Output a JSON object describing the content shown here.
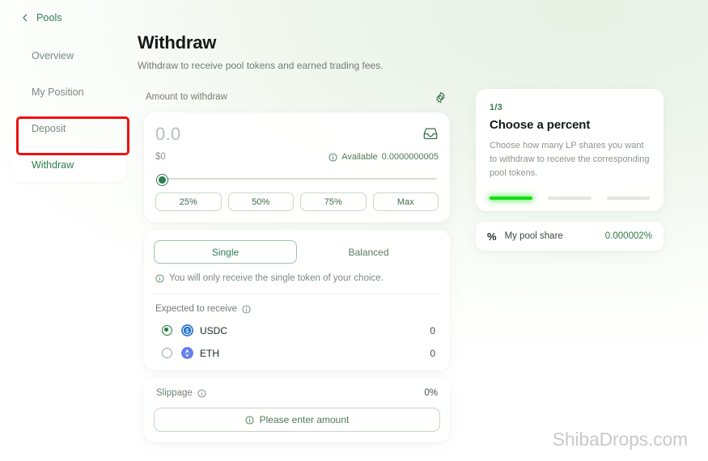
{
  "sidebar": {
    "back_label": "Pools",
    "back_icon": "chevron-left-icon",
    "items": [
      {
        "label": "Overview",
        "active": false
      },
      {
        "label": "My Position",
        "active": false
      },
      {
        "label": "Deposit",
        "active": false
      },
      {
        "label": "Withdraw",
        "active": true
      }
    ]
  },
  "header": {
    "title": "Withdraw",
    "subtitle": "Withdraw to receive pool tokens and earned trading fees."
  },
  "amount": {
    "section_label": "Amount to withdraw",
    "settings_icon": "gear-icon",
    "value": "0.0",
    "wallet_icon": "inbox-icon",
    "usd_value": "$0",
    "available_icon": "info-icon",
    "available_label": "Available",
    "available_value": "0.0000000005",
    "slider_percent": 0,
    "quick_percents": [
      "25%",
      "50%",
      "75%",
      "Max"
    ]
  },
  "mode": {
    "tabs": [
      {
        "label": "Single",
        "active": true
      },
      {
        "label": "Balanced",
        "active": false
      }
    ],
    "note_icon": "info-icon",
    "note": "You will only receive the single token of your choice.",
    "expected_label": "Expected to receive",
    "expected_icon": "info-icon",
    "tokens": [
      {
        "symbol": "USDC",
        "amount": "0",
        "selected": true,
        "icon_color": "#2775ca"
      },
      {
        "symbol": "ETH",
        "amount": "0",
        "selected": false,
        "icon_color": "#627eea"
      }
    ]
  },
  "slippage": {
    "label": "Slippage",
    "info_icon": "info-icon",
    "value": "0%",
    "cta_icon": "info-icon",
    "cta_label": "Please enter amount"
  },
  "stepper": {
    "step": "1/3",
    "title": "Choose a percent",
    "description": "Choose how many LP shares you want to withdraw to receive the corresponding pool tokens.",
    "progress": [
      true,
      false,
      false
    ]
  },
  "pool_share": {
    "icon": "percent-icon",
    "icon_glyph": "%",
    "label": "My pool share",
    "value": "0.000002%"
  },
  "watermark": "ShibaDrops.com",
  "colors": {
    "accent_green": "#2e7d4f",
    "bright_green": "#16dd16",
    "highlight_red": "#ee1111",
    "background_green": "#eaf3e8"
  }
}
